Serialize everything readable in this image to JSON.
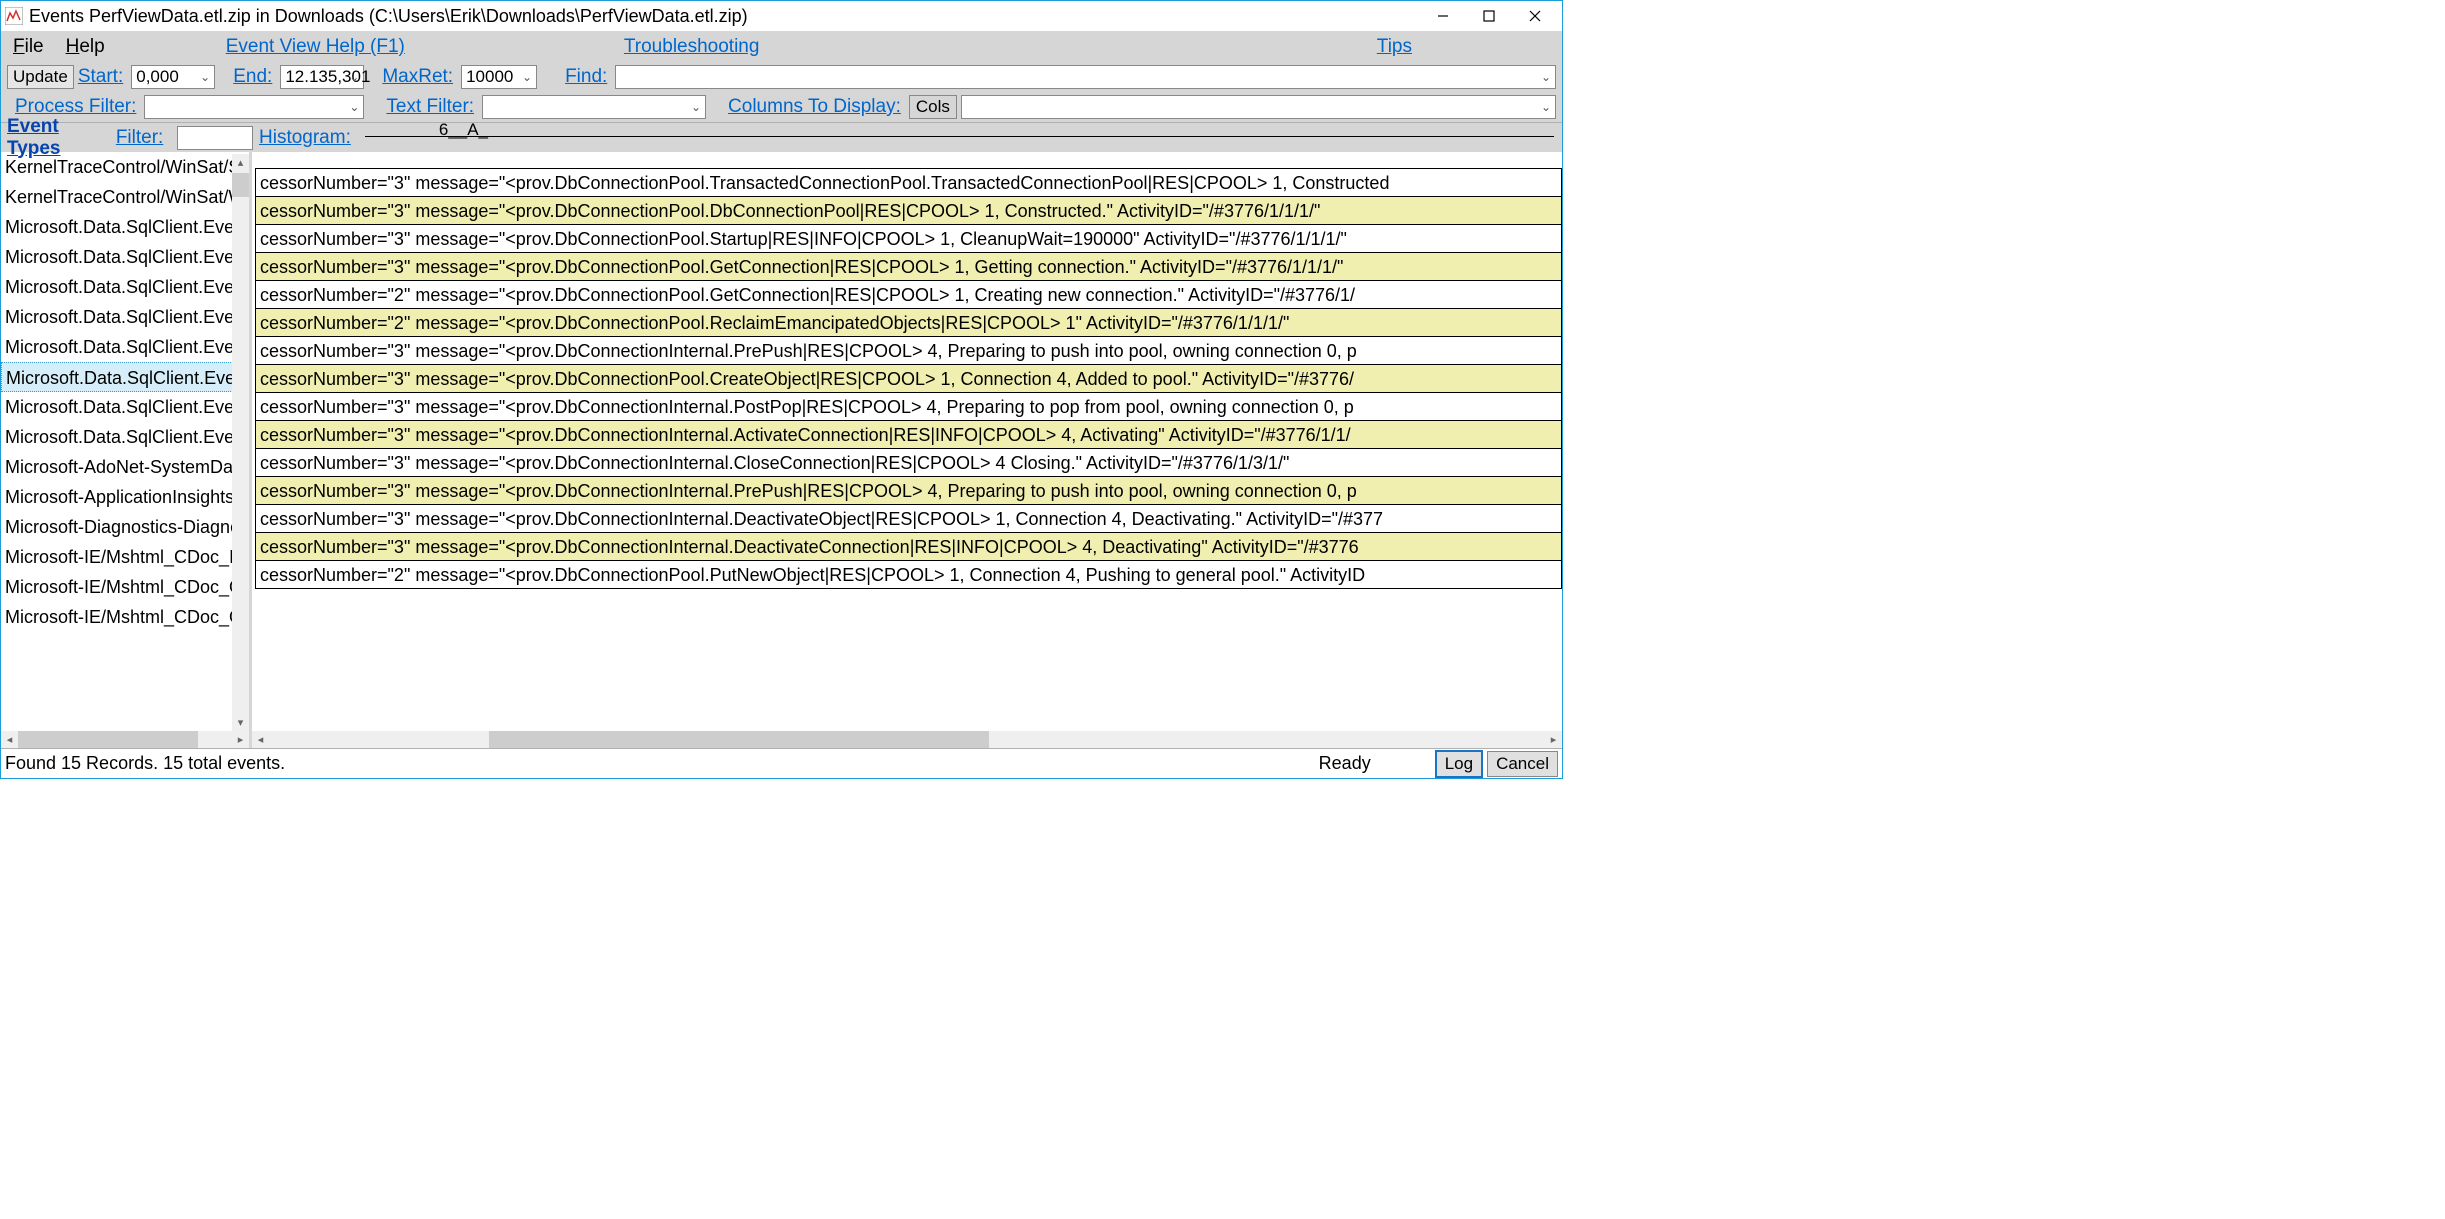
{
  "window": {
    "title": "Events PerfViewData.etl.zip in Downloads (C:\\Users\\Erik\\Downloads\\PerfViewData.etl.zip)"
  },
  "menu": {
    "file": "File",
    "help": "Help",
    "event_view_help": "Event View Help (F1)",
    "troubleshooting": "Troubleshooting",
    "tips": "Tips"
  },
  "toolbar": {
    "update": "Update",
    "start_label": "Start:",
    "start_value": "0,000",
    "end_label": "End:",
    "end_value": "12.135,301",
    "maxret_label": "MaxRet:",
    "maxret_value": "10000",
    "find_label": "Find:",
    "find_value": ""
  },
  "filters": {
    "process_filter_label": "Process Filter:",
    "process_filter_value": "",
    "text_filter_label": "Text Filter:",
    "text_filter_value": "",
    "columns_label": "Columns To Display:",
    "cols_btn": "Cols",
    "columns_value": ""
  },
  "split": {
    "event_types_label": "Event Types",
    "filter_label": "Filter:",
    "filter_value": "",
    "histogram_label": "Histogram:",
    "hist_marks": "6__A_"
  },
  "event_types": {
    "selected_index": 7,
    "items": [
      "KernelTraceControl/WinSat/SystemConfig",
      "KernelTraceControl/WinSat/WinSPR",
      "Microsoft.Data.SqlClient.EventSource/AdvancedTrace",
      "Microsoft.Data.SqlClient.EventSource/Event",
      "Microsoft.Data.SqlClient.EventSource/Event",
      "Microsoft.Data.SqlClient.EventSource/Event",
      "Microsoft.Data.SqlClient.EventSource/ManifestData",
      "Microsoft.Data.SqlClient.EventSource/PoolerTrace",
      "Microsoft.Data.SqlClient.EventSource/StateDump",
      "Microsoft.Data.SqlClient.EventSource/Trace",
      "Microsoft-AdoNet-SystemData/ManifestData",
      "Microsoft-ApplicationInsights-Core/ManifestData",
      "Microsoft-Diagnostics-DiagnosticSource/",
      "Microsoft-IE/Mshtml_CDoc_Invalidate",
      "Microsoft-IE/Mshtml_CDoc_OnPaint/Start",
      "Microsoft-IE/Mshtml_CDoc_OnPaint/Stop"
    ]
  },
  "events": {
    "rows": [
      {
        "alt": false,
        "text": "cessorNumber=\"3\" message=\"<prov.DbConnectionPool.TransactedConnectionPool.TransactedConnectionPool|RES|CPOOL> 1, Constructed"
      },
      {
        "alt": true,
        "text": "cessorNumber=\"3\" message=\"<prov.DbConnectionPool.DbConnectionPool|RES|CPOOL> 1, Constructed.\" ActivityID=\"/#3776/1/1/1/\""
      },
      {
        "alt": false,
        "text": "cessorNumber=\"3\" message=\"<prov.DbConnectionPool.Startup|RES|INFO|CPOOL> 1, CleanupWait=190000\" ActivityID=\"/#3776/1/1/1/\""
      },
      {
        "alt": true,
        "text": "cessorNumber=\"3\" message=\"<prov.DbConnectionPool.GetConnection|RES|CPOOL> 1, Getting connection.\" ActivityID=\"/#3776/1/1/1/\""
      },
      {
        "alt": false,
        "text": "cessorNumber=\"2\" message=\"<prov.DbConnectionPool.GetConnection|RES|CPOOL> 1, Creating new connection.\" ActivityID=\"/#3776/1/"
      },
      {
        "alt": true,
        "text": "cessorNumber=\"2\" message=\"<prov.DbConnectionPool.ReclaimEmancipatedObjects|RES|CPOOL> 1\" ActivityID=\"/#3776/1/1/1/\""
      },
      {
        "alt": false,
        "text": "cessorNumber=\"3\" message=\"<prov.DbConnectionInternal.PrePush|RES|CPOOL> 4, Preparing to push into pool, owning connection 0, p"
      },
      {
        "alt": true,
        "text": "cessorNumber=\"3\" message=\"<prov.DbConnectionPool.CreateObject|RES|CPOOL> 1, Connection 4, Added to pool.\" ActivityID=\"/#3776/"
      },
      {
        "alt": false,
        "text": "cessorNumber=\"3\" message=\"<prov.DbConnectionInternal.PostPop|RES|CPOOL> 4, Preparing to pop from pool,  owning connection 0, p"
      },
      {
        "alt": true,
        "text": "cessorNumber=\"3\" message=\"<prov.DbConnectionInternal.ActivateConnection|RES|INFO|CPOOL> 4, Activating\" ActivityID=\"/#3776/1/1/"
      },
      {
        "alt": false,
        "text": "cessorNumber=\"3\" message=\"<prov.DbConnectionInternal.CloseConnection|RES|CPOOL> 4 Closing.\" ActivityID=\"/#3776/1/3/1/\""
      },
      {
        "alt": true,
        "text": "cessorNumber=\"3\" message=\"<prov.DbConnectionInternal.PrePush|RES|CPOOL> 4, Preparing to push into pool, owning connection 0, p"
      },
      {
        "alt": false,
        "text": "cessorNumber=\"3\" message=\"<prov.DbConnectionInternal.DeactivateObject|RES|CPOOL> 1, Connection 4, Deactivating.\" ActivityID=\"/#377"
      },
      {
        "alt": true,
        "text": "cessorNumber=\"3\" message=\"<prov.DbConnectionInternal.DeactivateConnection|RES|INFO|CPOOL> 4, Deactivating\" ActivityID=\"/#3776"
      },
      {
        "alt": false,
        "text": "cessorNumber=\"2\" message=\"<prov.DbConnectionPool.PutNewObject|RES|CPOOL> 1, Connection 4, Pushing to general pool.\" ActivityID"
      }
    ]
  },
  "status": {
    "text": "Found 15 Records.  15 total events.",
    "ready": "Ready",
    "log": "Log",
    "cancel": "Cancel"
  }
}
